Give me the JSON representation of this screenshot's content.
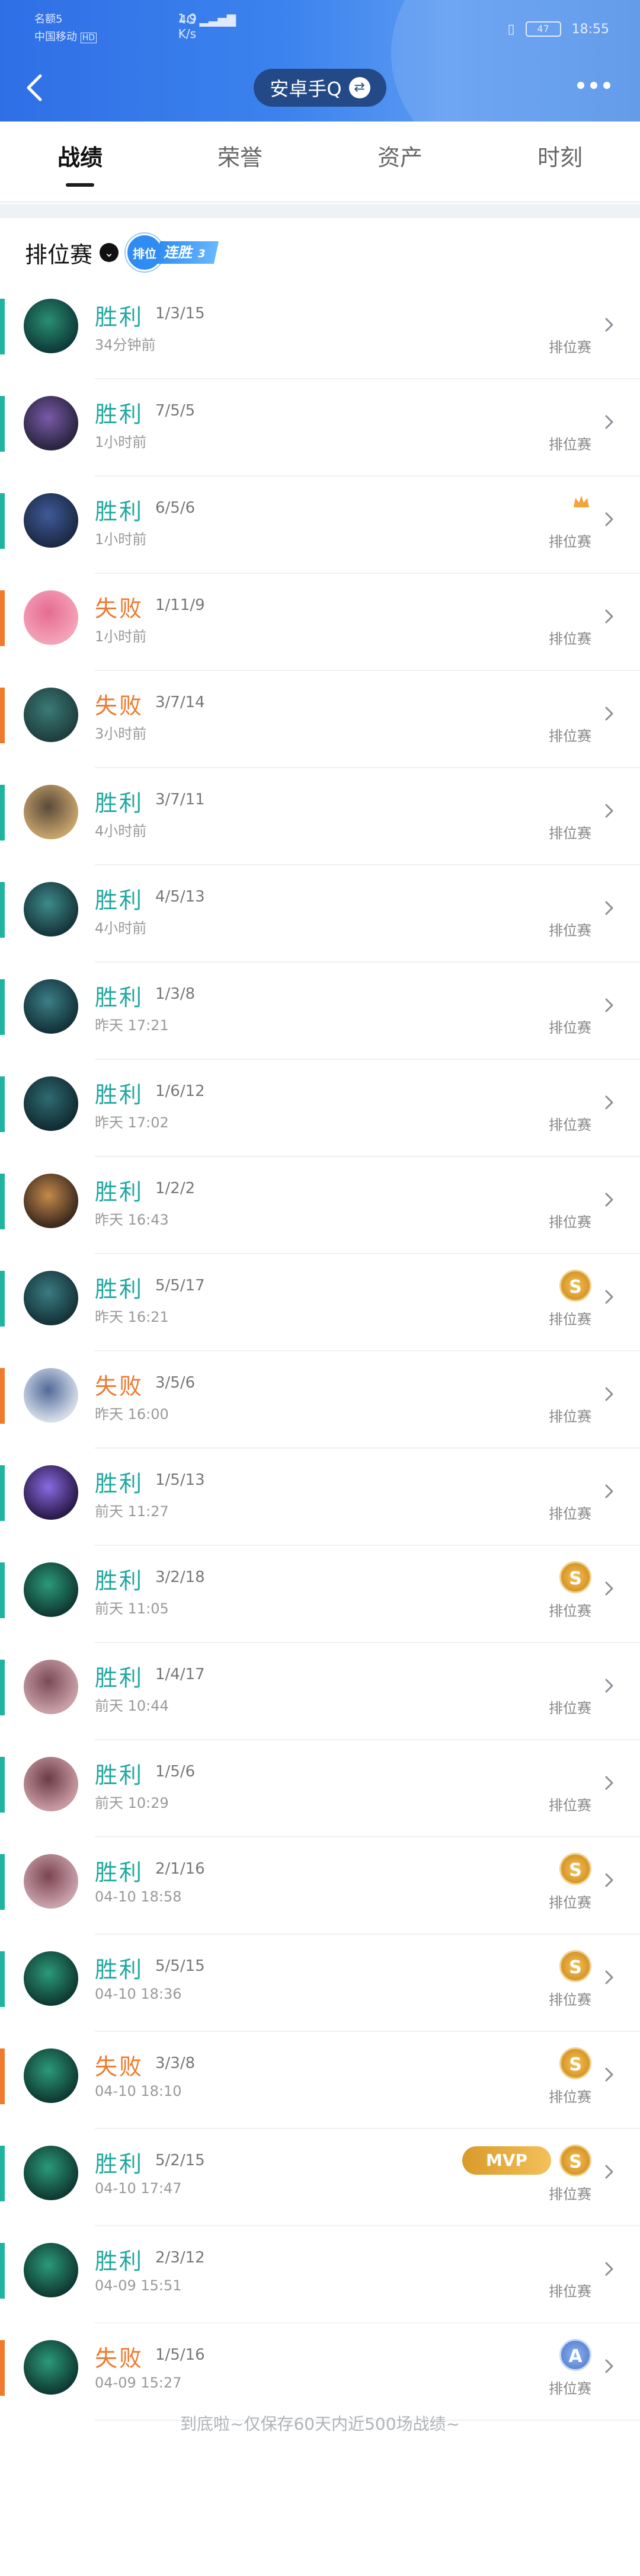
{
  "status_bar": {
    "carrier1": "名额5",
    "carrier2": "中国移动",
    "hd": "HD",
    "network": "4G",
    "speed": "1.9",
    "speed_unit": "K/s",
    "battery": "47",
    "clock": "18:55"
  },
  "header": {
    "account_name": "安卓手Q",
    "swap_icon": "swap-icon",
    "more_icon": "more-dots-icon",
    "back_icon": "back-arrow-icon"
  },
  "tabs": [
    {
      "label": "战绩",
      "active": true
    },
    {
      "label": "荣誉",
      "active": false
    },
    {
      "label": "资产",
      "active": false
    },
    {
      "label": "时刻",
      "active": false
    }
  ],
  "filter": {
    "label": "排位赛",
    "badge_icon_text": "排位",
    "badge_text": "连胜",
    "badge_count": "3"
  },
  "colors": {
    "win": "#1fa8a0",
    "loss": "#ef7a2e",
    "accent": "#2f6fe6"
  },
  "matches": [
    {
      "result": "胜利",
      "type": "win",
      "kda": "1/3/15",
      "time": "34分钟前",
      "mode": "排位赛",
      "medals": []
    },
    {
      "result": "胜利",
      "type": "win",
      "kda": "7/5/5",
      "time": "1小时前",
      "mode": "排位赛",
      "medals": []
    },
    {
      "result": "胜利",
      "type": "win",
      "kda": "6/5/6",
      "time": "1小时前",
      "mode": "排位赛",
      "medals": [
        "crown"
      ]
    },
    {
      "result": "失败",
      "type": "loss",
      "kda": "1/11/9",
      "time": "1小时前",
      "mode": "排位赛",
      "medals": []
    },
    {
      "result": "失败",
      "type": "loss",
      "kda": "3/7/14",
      "time": "3小时前",
      "mode": "排位赛",
      "medals": []
    },
    {
      "result": "胜利",
      "type": "win",
      "kda": "3/7/11",
      "time": "4小时前",
      "mode": "排位赛",
      "medals": []
    },
    {
      "result": "胜利",
      "type": "win",
      "kda": "4/5/13",
      "time": "4小时前",
      "mode": "排位赛",
      "medals": []
    },
    {
      "result": "胜利",
      "type": "win",
      "kda": "1/3/8",
      "time": "昨天 17:21",
      "mode": "排位赛",
      "medals": []
    },
    {
      "result": "胜利",
      "type": "win",
      "kda": "1/6/12",
      "time": "昨天 17:02",
      "mode": "排位赛",
      "medals": []
    },
    {
      "result": "胜利",
      "type": "win",
      "kda": "1/2/2",
      "time": "昨天 16:43",
      "mode": "排位赛",
      "medals": []
    },
    {
      "result": "胜利",
      "type": "win",
      "kda": "5/5/17",
      "time": "昨天 16:21",
      "mode": "排位赛",
      "medals": [
        "S"
      ]
    },
    {
      "result": "失败",
      "type": "loss",
      "kda": "3/5/6",
      "time": "昨天 16:00",
      "mode": "排位赛",
      "medals": []
    },
    {
      "result": "胜利",
      "type": "win",
      "kda": "1/5/13",
      "time": "前天 11:27",
      "mode": "排位赛",
      "medals": []
    },
    {
      "result": "胜利",
      "type": "win",
      "kda": "3/2/18",
      "time": "前天 11:05",
      "mode": "排位赛",
      "medals": [
        "S"
      ]
    },
    {
      "result": "胜利",
      "type": "win",
      "kda": "1/4/17",
      "time": "前天 10:44",
      "mode": "排位赛",
      "medals": []
    },
    {
      "result": "胜利",
      "type": "win",
      "kda": "1/5/6",
      "time": "前天 10:29",
      "mode": "排位赛",
      "medals": []
    },
    {
      "result": "胜利",
      "type": "win",
      "kda": "2/1/16",
      "time": "04-10 18:58",
      "mode": "排位赛",
      "medals": [
        "S"
      ]
    },
    {
      "result": "胜利",
      "type": "win",
      "kda": "5/5/15",
      "time": "04-10 18:36",
      "mode": "排位赛",
      "medals": [
        "S"
      ]
    },
    {
      "result": "失败",
      "type": "loss",
      "kda": "3/3/8",
      "time": "04-10 18:10",
      "mode": "排位赛",
      "medals": [
        "S"
      ]
    },
    {
      "result": "胜利",
      "type": "win",
      "kda": "5/2/15",
      "time": "04-10 17:47",
      "mode": "排位赛",
      "medals": [
        "MVP",
        "S"
      ]
    },
    {
      "result": "胜利",
      "type": "win",
      "kda": "2/3/12",
      "time": "04-09 15:51",
      "mode": "排位赛",
      "medals": []
    },
    {
      "result": "失败",
      "type": "loss",
      "kda": "1/5/16",
      "time": "04-09 15:27",
      "mode": "排位赛",
      "medals": [
        "A"
      ]
    }
  ],
  "medal_labels": {
    "S": "S",
    "A": "A",
    "MVP": "MVP"
  },
  "footer": "到底啦~仅保存60天内近500场战绩~"
}
